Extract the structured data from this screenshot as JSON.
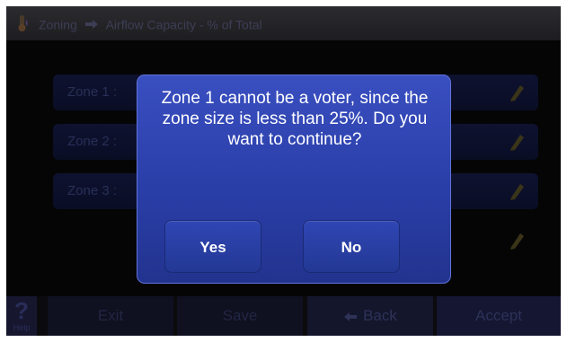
{
  "header": {
    "breadcrumb_section": "Zoning",
    "breadcrumb_page": "Airflow Capacity  - % of Total"
  },
  "zones": [
    {
      "label": "Zone 1 :"
    },
    {
      "label": "Zone 2 :"
    },
    {
      "label": "Zone 3 :"
    },
    {
      "label": ""
    }
  ],
  "dialog": {
    "message": "Zone 1 cannot be a voter, since the zone size is less than 25%. Do you want to continue?",
    "yes_label": "Yes",
    "no_label": "No"
  },
  "bottom_bar": {
    "help_symbol": "?",
    "help_label": "Help",
    "exit_label": "Exit",
    "save_label": "Save",
    "back_label": "Back",
    "accept_label": "Accept"
  },
  "colors": {
    "dialog_blue": "#2a3ea8",
    "dimmed_text": "#283058"
  }
}
